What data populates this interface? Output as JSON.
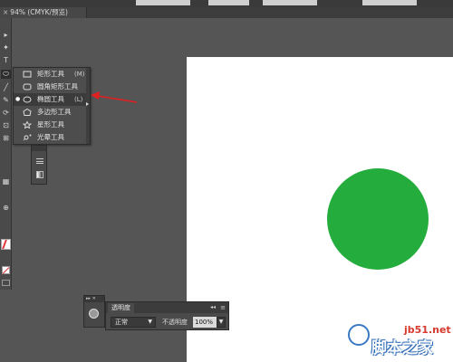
{
  "document_tab": {
    "title": "94% (CMYK/预览)",
    "close_glyph": "×"
  },
  "toolbar": {
    "tools": [
      {
        "glyph": "▸",
        "icon": "selection-arrow-icon"
      },
      {
        "glyph": "✦",
        "icon": "pen-icon"
      },
      {
        "glyph": "T",
        "icon": "type-icon"
      },
      {
        "glyph": "⬭",
        "icon": "ellipse-tool-icon"
      },
      {
        "glyph": "╱",
        "icon": "paintbrush-icon"
      },
      {
        "glyph": "✎",
        "icon": "pencil-icon"
      },
      {
        "glyph": "⟳",
        "icon": "rotate-icon"
      },
      {
        "glyph": "⊡",
        "icon": "free-transform-icon"
      },
      {
        "glyph": "⊞",
        "icon": "shape-builder-icon"
      },
      {
        "glyph": "▦",
        "icon": "graph-icon"
      },
      {
        "glyph": "⊕",
        "icon": "zoom-icon"
      }
    ]
  },
  "flyout": {
    "items": [
      {
        "label": "矩形工具",
        "shortcut": "(M)",
        "icon": "rectangle-tool-icon",
        "selected": false
      },
      {
        "label": "圆角矩形工具",
        "shortcut": "",
        "icon": "rounded-rectangle-tool-icon",
        "selected": false
      },
      {
        "label": "椭圆工具",
        "shortcut": "(L)",
        "icon": "ellipse-tool-icon",
        "selected": true
      },
      {
        "label": "多边形工具",
        "shortcut": "",
        "icon": "polygon-tool-icon",
        "selected": false
      },
      {
        "label": "星形工具",
        "shortcut": "",
        "icon": "star-tool-icon",
        "selected": false
      },
      {
        "label": "光晕工具",
        "shortcut": "",
        "icon": "flare-tool-icon",
        "selected": false
      }
    ]
  },
  "transparency_panel": {
    "tab_label": "透明度",
    "blend_mode": "正常",
    "opacity_label": "不透明度",
    "opacity_value": "100%",
    "collapse_glyph": "◂◂",
    "menu_glyph": "≡"
  },
  "side_stub": {
    "header": "▸▸ ✕"
  },
  "artwork": {
    "circle_color": "#24ad3c",
    "artboard_color": "#ffffff"
  },
  "watermark": {
    "url": "jb51.net",
    "name": "脚本之家"
  },
  "colors": {
    "workspace": "#555555",
    "panel": "#4a4a4a",
    "annotation_arrow": "#e02020"
  }
}
